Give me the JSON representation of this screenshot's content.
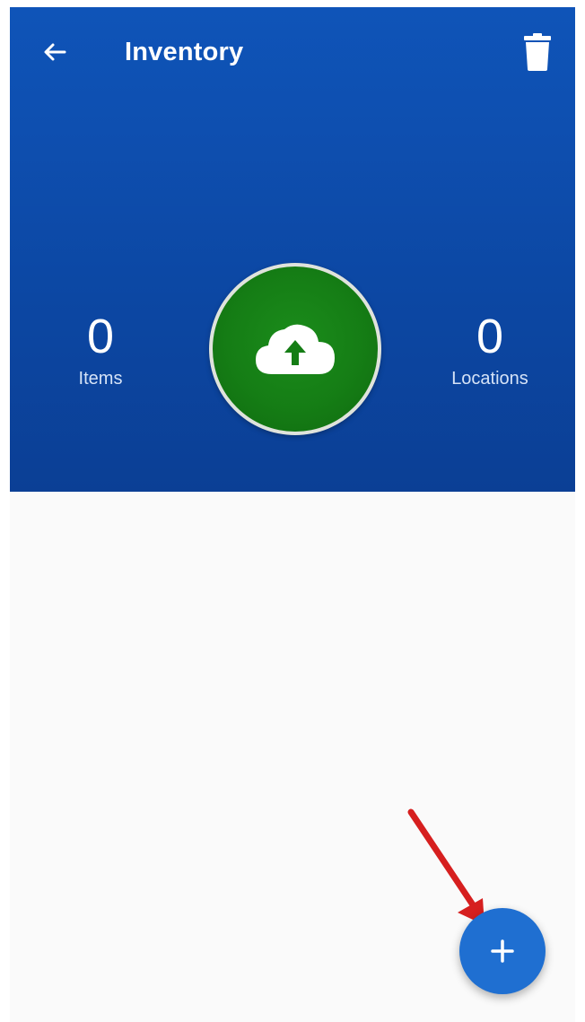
{
  "appbar": {
    "title": "Inventory",
    "back_icon": "arrow-left-icon",
    "delete_icon": "trash-icon"
  },
  "stats": {
    "items": {
      "value": "0",
      "label": "Items"
    },
    "locations": {
      "value": "0",
      "label": "Locations"
    }
  },
  "sync": {
    "icon": "cloud-upload-icon"
  },
  "fab": {
    "icon": "plus-icon"
  },
  "annotation": {
    "icon": "red-arrow-icon"
  },
  "colors": {
    "header_blue": "#0e4fb0",
    "sync_green": "#157d15",
    "fab_blue": "#1f6fd1",
    "annotation_red": "#d61f1f",
    "content_background": "#fafafa"
  }
}
